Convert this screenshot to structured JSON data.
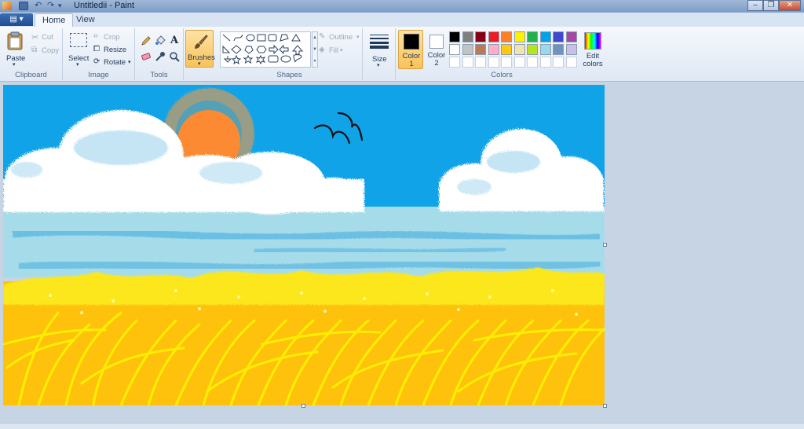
{
  "window": {
    "title": "Untitledii - Paint"
  },
  "tabs": [
    {
      "label": "Home"
    },
    {
      "label": "View"
    }
  ],
  "ribbon": {
    "clipboard": {
      "paste": "Paste",
      "cut": "Cut",
      "copy": "Copy",
      "group": "Clipboard"
    },
    "image": {
      "select": "Select",
      "crop": "Crop",
      "resize": "Resize",
      "rotate": "Rotate",
      "group": "Image"
    },
    "tools": {
      "group": "Tools"
    },
    "brushes": {
      "label": "Brushes"
    },
    "shapes": {
      "outline": "Outline",
      "fill": "Fill",
      "group": "Shapes"
    },
    "size": {
      "label": "Size"
    },
    "colors": {
      "color1": "Color 1",
      "color2": "Color 2",
      "edit": "Edit colors",
      "group": "Colors",
      "color1_value": "#000000",
      "color2_value": "#ffffff",
      "palette_row1": [
        "#000000",
        "#7f7f7f",
        "#880015",
        "#ed1c24",
        "#ff7f27",
        "#fff200",
        "#22b14c",
        "#00a2e8",
        "#3f48cc",
        "#a349a4"
      ],
      "palette_row2": [
        "#ffffff",
        "#c3c3c3",
        "#b97a57",
        "#ffaec9",
        "#ffc90e",
        "#efe4b0",
        "#b5e61d",
        "#99d9ea",
        "#7092be",
        "#c8bfe7"
      ]
    }
  }
}
